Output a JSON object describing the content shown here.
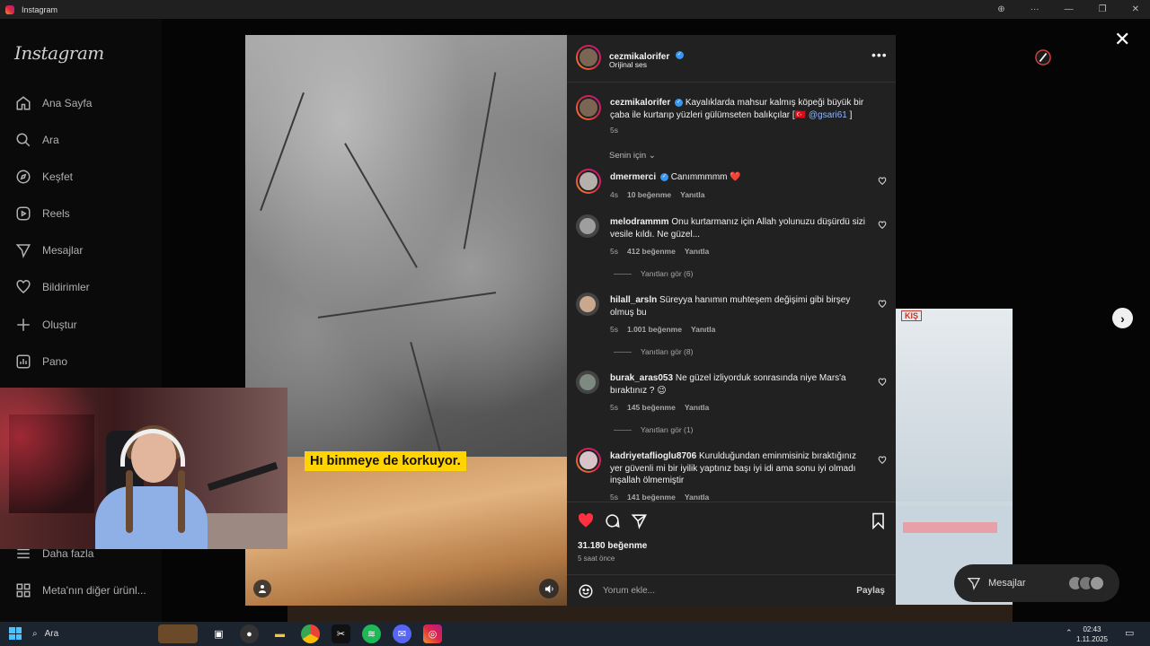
{
  "window": {
    "title": "Instagram"
  },
  "sidebar": {
    "logo": "Instagram",
    "items": [
      {
        "label": "Ana Sayfa",
        "icon": "home-icon"
      },
      {
        "label": "Ara",
        "icon": "search-icon"
      },
      {
        "label": "Keşfet",
        "icon": "compass-icon"
      },
      {
        "label": "Reels",
        "icon": "reels-icon"
      },
      {
        "label": "Mesajlar",
        "icon": "send-icon"
      },
      {
        "label": "Bildirimler",
        "icon": "heart-icon"
      },
      {
        "label": "Oluştur",
        "icon": "plus-icon"
      },
      {
        "label": "Pano",
        "icon": "chart-icon"
      }
    ],
    "bottom": [
      {
        "label": "Daha fazla",
        "icon": "menu-icon"
      },
      {
        "label": "Meta'nın diğer ürünl...",
        "icon": "grid-icon"
      }
    ]
  },
  "video": {
    "caption": "Hı binmeye de korkuyor."
  },
  "post": {
    "username": "cezmikalorifer",
    "audio": "Orijinal ses",
    "caption_user": "cezmikalorifer",
    "caption_text": "Kayalıklarda mahsur kalmış köpeği büyük bir çaba ile kurtarıp yüzleri gülümseten balıkçılar [🇹🇷 ",
    "caption_mention": "@gsari61",
    "caption_end": " ]",
    "caption_time": "5s",
    "sort_label": "Senin için",
    "likes": "31.180 beğenme",
    "time_ago": "5 saat önce",
    "comment_placeholder": "Yorum ekle...",
    "share_label": "Paylaş"
  },
  "comments": [
    {
      "user": "dmermerci",
      "text": "Canımmmmm ❤️",
      "time": "4s",
      "likes": "10 beğenme",
      "reply": "Yanıtla",
      "verified": true
    },
    {
      "user": "melodrammm",
      "text": "Onu kurtarmanız için Allah yolunuzu düşürdü sizi vesile kıldı. Ne güzel...",
      "time": "5s",
      "likes": "412 beğenme",
      "reply": "Yanıtla",
      "replies": "Yanıtları gör (6)"
    },
    {
      "user": "hilall_arsln",
      "text": "Süreyya hanımın muhteşem değişimi gibi birşey olmuş bu",
      "time": "5s",
      "likes": "1.001 beğenme",
      "reply": "Yanıtla",
      "replies": "Yanıtları gör (8)"
    },
    {
      "user": "burak_aras053",
      "text": "Ne güzel izliyorduk sonrasında niye Mars'a bıraktınız ? 😉",
      "time": "5s",
      "likes": "145 beğenme",
      "reply": "Yanıtla",
      "replies": "Yanıtları gör (1)"
    },
    {
      "user": "kadriyetaflioglu8706",
      "text": "Kurulduğundan eminmisiniz bıraktığınız yer güvenli mi bir iyilik yaptınız başı iyi idi ama sonu iyi olmadı inşallah ölmemiştir",
      "time": "5s",
      "likes": "141 beğenme",
      "reply": "Yanıtla"
    }
  ],
  "background": {
    "kis_label": "KIŞ"
  },
  "messages_float": {
    "label": "Mesajlar"
  },
  "taskbar": {
    "search": "Ara",
    "time": "02:43",
    "date": "1.11.2025"
  },
  "colors": {
    "accent": "#3897f0",
    "like_red": "#ff3040",
    "panel": "#212121"
  }
}
